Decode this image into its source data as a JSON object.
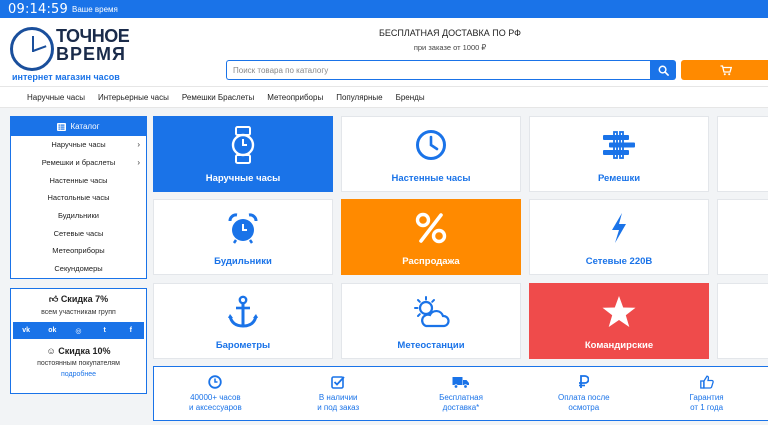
{
  "topbar": {
    "time": "09:14:59",
    "caption": "Ваше время"
  },
  "logo": {
    "line1": "ТОЧНОЕ",
    "line2": "ВРЕМЯ",
    "tagline": "интернет магазин часов"
  },
  "promo": {
    "line1": "БЕСПЛАТНАЯ ДОСТАВКА ПО РФ",
    "line2": "при заказе от 1000 ₽"
  },
  "search": {
    "placeholder": "Поиск товара по каталогу",
    "icon": "search-icon"
  },
  "nav": {
    "items": [
      "Наручные часы",
      "Интерьерные часы",
      "Ремешки Браслеты",
      "Метеоприборы",
      "Популярные",
      "Бренды"
    ]
  },
  "catalog": {
    "title": "Каталог",
    "items": [
      "Наручные часы",
      "Ремешки и браслеты",
      "Настенные часы",
      "Настольные часы",
      "Будильники",
      "Сетевые часы",
      "Метеоприборы",
      "Секундомеры"
    ]
  },
  "discounts": {
    "group_title": "Скидка 7%",
    "group_sub": "всем участникам групп",
    "socials": [
      "vk",
      "ok",
      "instagram",
      "twitter",
      "facebook"
    ],
    "loyal_title": "Скидка 10%",
    "loyal_sub": "постоянным покупателям",
    "loyal_link": "подробнее"
  },
  "tiles": [
    {
      "label": "Наручные часы",
      "icon": "wristwatch-icon",
      "style": "blue"
    },
    {
      "label": "Настенные часы",
      "icon": "wall-clock-icon",
      "style": "white"
    },
    {
      "label": "Ремешки",
      "icon": "strap-icon",
      "style": "white"
    },
    {
      "label": "Будильники",
      "icon": "alarm-clock-icon",
      "style": "white"
    },
    {
      "label": "Распродажа",
      "icon": "percent-icon",
      "style": "orange"
    },
    {
      "label": "Сетевые 220В",
      "icon": "lightning-icon",
      "style": "white"
    },
    {
      "label": "Барометры",
      "icon": "anchor-icon",
      "style": "white"
    },
    {
      "label": "Метеостанции",
      "icon": "weather-icon",
      "style": "white"
    },
    {
      "label": "Командирские",
      "icon": "star-icon",
      "style": "red"
    }
  ],
  "benefits": [
    {
      "line1": "40000+ часов",
      "line2": "и аксессуаров",
      "icon": "clock-icon"
    },
    {
      "line1": "В наличии",
      "line2": "и под заказ",
      "icon": "checkbox-icon"
    },
    {
      "line1": "Бесплатная",
      "line2": "доставка*",
      "icon": "truck-icon"
    },
    {
      "line1": "Оплата после",
      "line2": "осмотра",
      "icon": "ruble-icon"
    },
    {
      "line1": "Гарантия",
      "line2": "от 1 года",
      "icon": "thumbs-up-icon"
    }
  ],
  "colors": {
    "primary": "#1a73e8",
    "orange": "#ff8a00",
    "red": "#ef4b4b",
    "dark_text": "#1a2b4a"
  }
}
